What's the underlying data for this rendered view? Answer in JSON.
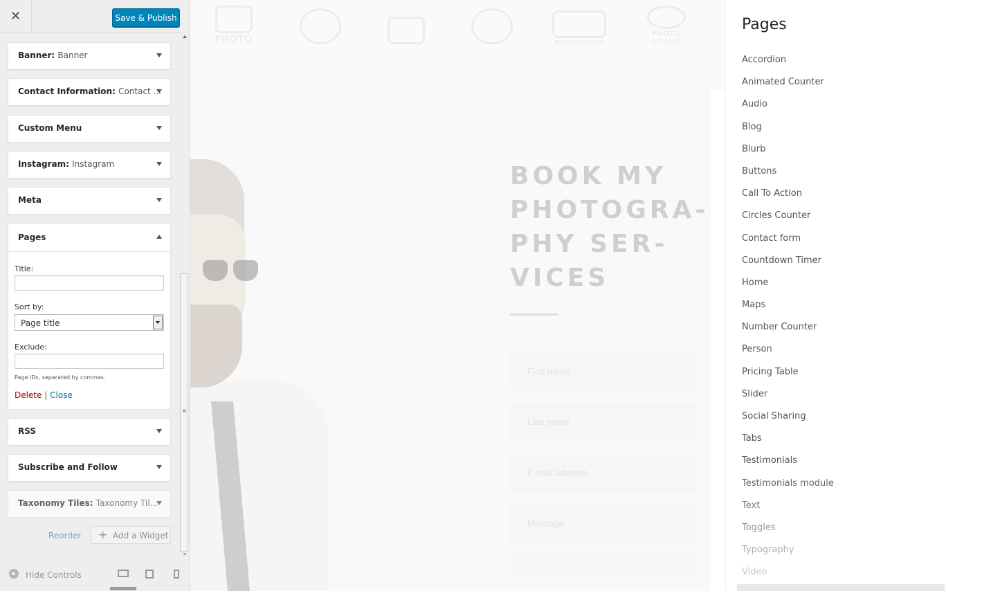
{
  "customizer": {
    "close_label": "✕",
    "publish_label": "Save & Publish",
    "widgets_top": [
      {
        "name": "Banner",
        "sub": "Banner"
      },
      {
        "name": "Contact Information",
        "sub": "Contact ..."
      },
      {
        "name": "Custom Menu",
        "sub": ""
      },
      {
        "name": "Instagram",
        "sub": "Instagram"
      },
      {
        "name": "Meta",
        "sub": ""
      }
    ],
    "pages_widget": {
      "title": "Pages",
      "title_label": "Title:",
      "title_value": "",
      "sortby_label": "Sort by:",
      "sortby_value": "Page title",
      "exclude_label": "Exclude:",
      "exclude_value": "",
      "help": "Page IDs, separated by commas.",
      "delete_label": "Delete",
      "separator": "|",
      "close_label": "Close"
    },
    "widgets_bottom": [
      {
        "name": "RSS",
        "sub": ""
      },
      {
        "name": "Subscribe and Follow",
        "sub": ""
      },
      {
        "name": "Taxonomy Tiles",
        "sub": "Taxonomy Til..."
      }
    ],
    "reorder_label": "Reorder",
    "add_widget_label": "Add a Widget",
    "hide_controls_label": "Hide Controls",
    "colors": {
      "accent": "#0085ba",
      "link": "#0073aa",
      "delete": "#aa0000"
    }
  },
  "preview": {
    "logos": [
      "PHOTO",
      "",
      "",
      "",
      "PHOTOGRAPHY",
      "PHOTO STUDIO"
    ],
    "heading": "BOOK MY PHOTOGRA-PHY SER-VICES",
    "form": {
      "first_name": "First name",
      "last_name": "Last name",
      "email": "E-mail address",
      "message": "Message"
    },
    "sidebar": {
      "title": "Pages",
      "items": [
        "Accordion",
        "Animated Counter",
        "Audio",
        "Blog",
        "Blurb",
        "Buttons",
        "Call To Action",
        "Circles Counter",
        "Contact form",
        "Countdown Timer",
        "Home",
        "Maps",
        "Number Counter",
        "Person",
        "Pricing Table",
        "Slider",
        "Social Sharing",
        "Tabs",
        "Testimonials",
        "Testimonials module",
        "Text",
        "Toggles",
        "Typography",
        "Video"
      ]
    }
  }
}
